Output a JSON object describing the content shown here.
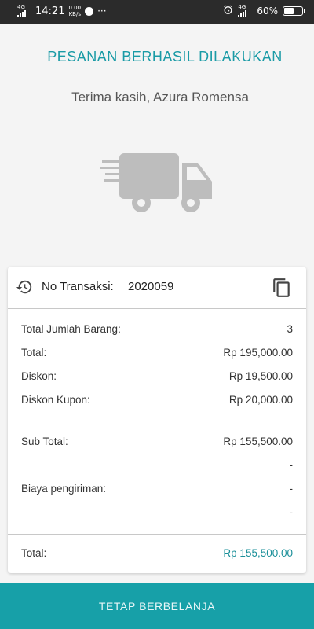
{
  "status_bar": {
    "network_left": "4G",
    "time": "14:21",
    "net_speed_value": "0.00",
    "net_speed_unit": "KB/s",
    "more": "···",
    "network_right": "4G",
    "battery": "60%",
    "battery_level": 0.6
  },
  "header": {
    "title": "PESANAN BERHASIL DILAKUKAN",
    "subtitle": "Terima kasih, Azura Romensa"
  },
  "illustration": {
    "icon": "delivery-truck-icon",
    "color": "#bdbdbd"
  },
  "transaction": {
    "label": "No Transaksi:",
    "number": "2020059",
    "history_icon": "history-icon",
    "copy_icon": "copy-icon"
  },
  "summary": {
    "items": [
      {
        "label": "Total Jumlah Barang:",
        "value": "3"
      },
      {
        "label": "Total:",
        "value": "Rp 195,000.00"
      },
      {
        "label": "Diskon:",
        "value": "Rp 19,500.00"
      },
      {
        "label": "Diskon Kupon:",
        "value": "Rp 20,000.00"
      }
    ],
    "subtotal_label": "Sub Total:",
    "subtotal_value": "Rp 155,500.00",
    "subtotal_extra": "-",
    "shipping_label": "Biaya pengiriman:",
    "shipping_value": "-",
    "shipping_extra": "-",
    "grand_total_label": "Total:",
    "grand_total_value": "Rp 155,500.00"
  },
  "cta": {
    "label": "TETAP BERBELANJA"
  },
  "colors": {
    "accent": "#1a9ba6",
    "button": "#17a0a8",
    "status_bar": "#2b2b2b"
  }
}
